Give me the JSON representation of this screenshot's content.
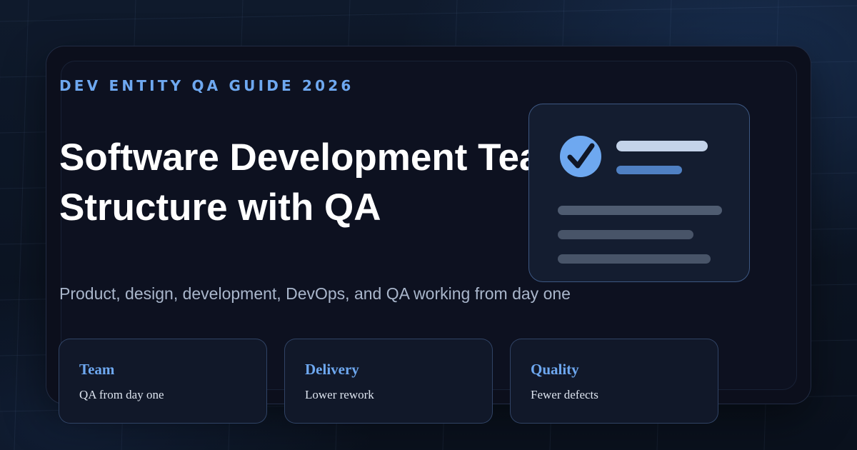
{
  "hero": {
    "eyebrow": "DEV ENTITY QA GUIDE 2026",
    "title_line1": "Software Development Team",
    "title_line2": "Structure with QA",
    "subtitle": "Product, design, development, DevOps, and QA working from day one"
  },
  "widget": {
    "icon": "check-circle-icon"
  },
  "stats": [
    {
      "label": "Team",
      "value": "QA from day one"
    },
    {
      "label": "Delivery",
      "value": "Lower rework"
    },
    {
      "label": "Quality",
      "value": "Fewer defects"
    }
  ],
  "colors": {
    "accent": "#6ea8f0",
    "background": "#0b1220",
    "card": "#0c0f1c",
    "title": "#ffffff",
    "subtitle": "#a9b6cb"
  }
}
